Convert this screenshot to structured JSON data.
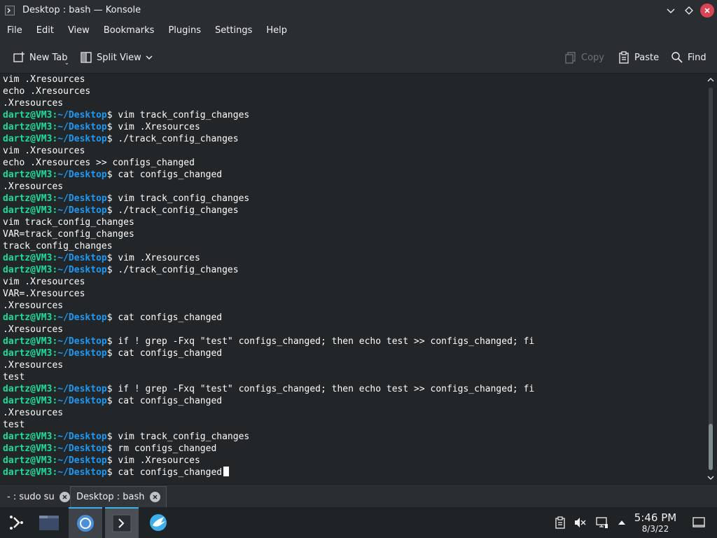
{
  "window": {
    "title": "Desktop : bash — Konsole",
    "icons": {
      "app": "konsole-icon",
      "minimize": "chevron-down-icon",
      "maximize": "diamond-icon",
      "close": "close-icon"
    }
  },
  "menubar": {
    "items": [
      "File",
      "Edit",
      "View",
      "Bookmarks",
      "Plugins",
      "Settings",
      "Help"
    ]
  },
  "toolbar": {
    "new_tab": "New Tab",
    "split_view": "Split View",
    "copy": "Copy",
    "paste": "Paste",
    "find": "Find"
  },
  "terminal": {
    "prompt_user": "dartz@VM3",
    "prompt_path": "~/Desktop",
    "lines": [
      {
        "type": "out",
        "text": "vim .Xresources"
      },
      {
        "type": "out",
        "text": "echo .Xresources"
      },
      {
        "type": "out",
        "text": ".Xresources"
      },
      {
        "type": "cmd",
        "text": "vim track_config_changes"
      },
      {
        "type": "cmd",
        "text": "vim .Xresources"
      },
      {
        "type": "cmd",
        "text": "./track_config_changes"
      },
      {
        "type": "out",
        "text": "vim .Xresources"
      },
      {
        "type": "out",
        "text": "echo .Xresources >> configs_changed"
      },
      {
        "type": "cmd",
        "text": "cat configs_changed"
      },
      {
        "type": "out",
        "text": ".Xresources"
      },
      {
        "type": "cmd",
        "text": "vim track_config_changes"
      },
      {
        "type": "cmd",
        "text": "./track_config_changes"
      },
      {
        "type": "out",
        "text": "vim track_config_changes"
      },
      {
        "type": "out",
        "text": "VAR=track_config_changes"
      },
      {
        "type": "out",
        "text": "track_config_changes"
      },
      {
        "type": "cmd",
        "text": "vim .Xresources"
      },
      {
        "type": "cmd",
        "text": "./track_config_changes"
      },
      {
        "type": "out",
        "text": "vim .Xresources"
      },
      {
        "type": "out",
        "text": "VAR=.Xresources"
      },
      {
        "type": "out",
        "text": ".Xresources"
      },
      {
        "type": "cmd",
        "text": "cat configs_changed"
      },
      {
        "type": "out",
        "text": ".Xresources"
      },
      {
        "type": "cmd",
        "text": "if ! grep -Fxq \"test\" configs_changed; then echo test >> configs_changed; fi"
      },
      {
        "type": "cmd",
        "text": "cat configs_changed"
      },
      {
        "type": "out",
        "text": ".Xresources"
      },
      {
        "type": "out",
        "text": "test"
      },
      {
        "type": "cmd",
        "text": "if ! grep -Fxq \"test\" configs_changed; then echo test >> configs_changed; fi"
      },
      {
        "type": "cmd",
        "text": "cat configs_changed"
      },
      {
        "type": "out",
        "text": ".Xresources"
      },
      {
        "type": "out",
        "text": "test"
      },
      {
        "type": "cmd",
        "text": "vim track_config_changes"
      },
      {
        "type": "cmd",
        "text": "rm configs_changed"
      },
      {
        "type": "cmd",
        "text": "vim .Xresources"
      },
      {
        "type": "cmd",
        "text": "cat configs_changed",
        "cursor": true
      }
    ],
    "colors": {
      "user": "#1cdc9a",
      "path": "#1d99f3",
      "text": "#fcfcfc",
      "background": "#232629"
    }
  },
  "tabs": [
    {
      "label": "- : sudo su",
      "active": false
    },
    {
      "label": "Desktop : bash",
      "active": true
    }
  ],
  "taskbar": {
    "apps": [
      "launcher-icon",
      "file-manager-icon",
      "chromium-icon",
      "konsole-icon",
      "web-browser-icon"
    ],
    "tray": [
      "clipboard-icon",
      "volume-muted-icon",
      "network-icon",
      "expand-tray-icon"
    ],
    "time": "5:46 PM",
    "date": "8/3/22"
  },
  "accent": "#3daee9"
}
